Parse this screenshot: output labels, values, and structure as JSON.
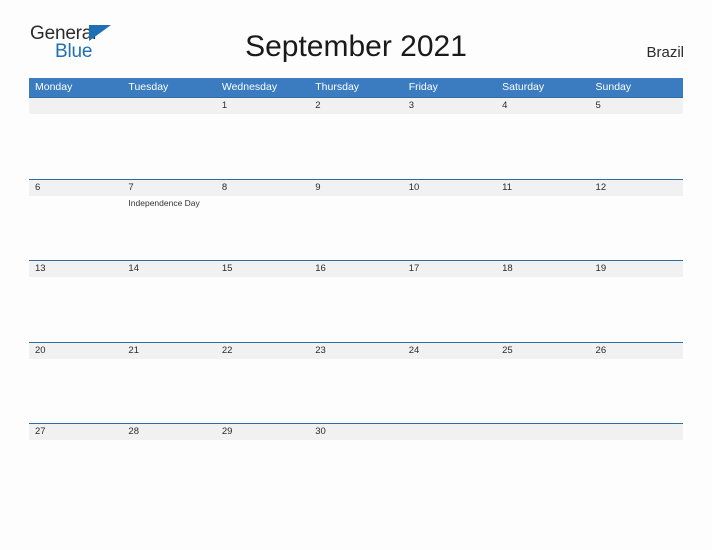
{
  "brand": {
    "word_one": "General",
    "word_two": "Blue",
    "triangle_icon": "triangle-icon",
    "accent_color": "#1f6fb4"
  },
  "header": {
    "title": "September 2021",
    "country": "Brazil"
  },
  "colors": {
    "header_band": "#3b7cc0",
    "rule": "#2e6da4",
    "date_band": "#f1f1f1",
    "page_background": "#fdfdfd"
  },
  "calendar": {
    "weekdays": [
      "Monday",
      "Tuesday",
      "Wednesday",
      "Thursday",
      "Friday",
      "Saturday",
      "Sunday"
    ],
    "weeks": [
      {
        "days": [
          {
            "date": "",
            "event": ""
          },
          {
            "date": "",
            "event": ""
          },
          {
            "date": "1",
            "event": ""
          },
          {
            "date": "2",
            "event": ""
          },
          {
            "date": "3",
            "event": ""
          },
          {
            "date": "4",
            "event": ""
          },
          {
            "date": "5",
            "event": ""
          }
        ]
      },
      {
        "days": [
          {
            "date": "6",
            "event": ""
          },
          {
            "date": "7",
            "event": "Independence Day"
          },
          {
            "date": "8",
            "event": ""
          },
          {
            "date": "9",
            "event": ""
          },
          {
            "date": "10",
            "event": ""
          },
          {
            "date": "11",
            "event": ""
          },
          {
            "date": "12",
            "event": ""
          }
        ]
      },
      {
        "days": [
          {
            "date": "13",
            "event": ""
          },
          {
            "date": "14",
            "event": ""
          },
          {
            "date": "15",
            "event": ""
          },
          {
            "date": "16",
            "event": ""
          },
          {
            "date": "17",
            "event": ""
          },
          {
            "date": "18",
            "event": ""
          },
          {
            "date": "19",
            "event": ""
          }
        ]
      },
      {
        "days": [
          {
            "date": "20",
            "event": ""
          },
          {
            "date": "21",
            "event": ""
          },
          {
            "date": "22",
            "event": ""
          },
          {
            "date": "23",
            "event": ""
          },
          {
            "date": "24",
            "event": ""
          },
          {
            "date": "25",
            "event": ""
          },
          {
            "date": "26",
            "event": ""
          }
        ]
      },
      {
        "days": [
          {
            "date": "27",
            "event": ""
          },
          {
            "date": "28",
            "event": ""
          },
          {
            "date": "29",
            "event": ""
          },
          {
            "date": "30",
            "event": ""
          },
          {
            "date": "",
            "event": ""
          },
          {
            "date": "",
            "event": ""
          },
          {
            "date": "",
            "event": ""
          }
        ]
      }
    ]
  }
}
